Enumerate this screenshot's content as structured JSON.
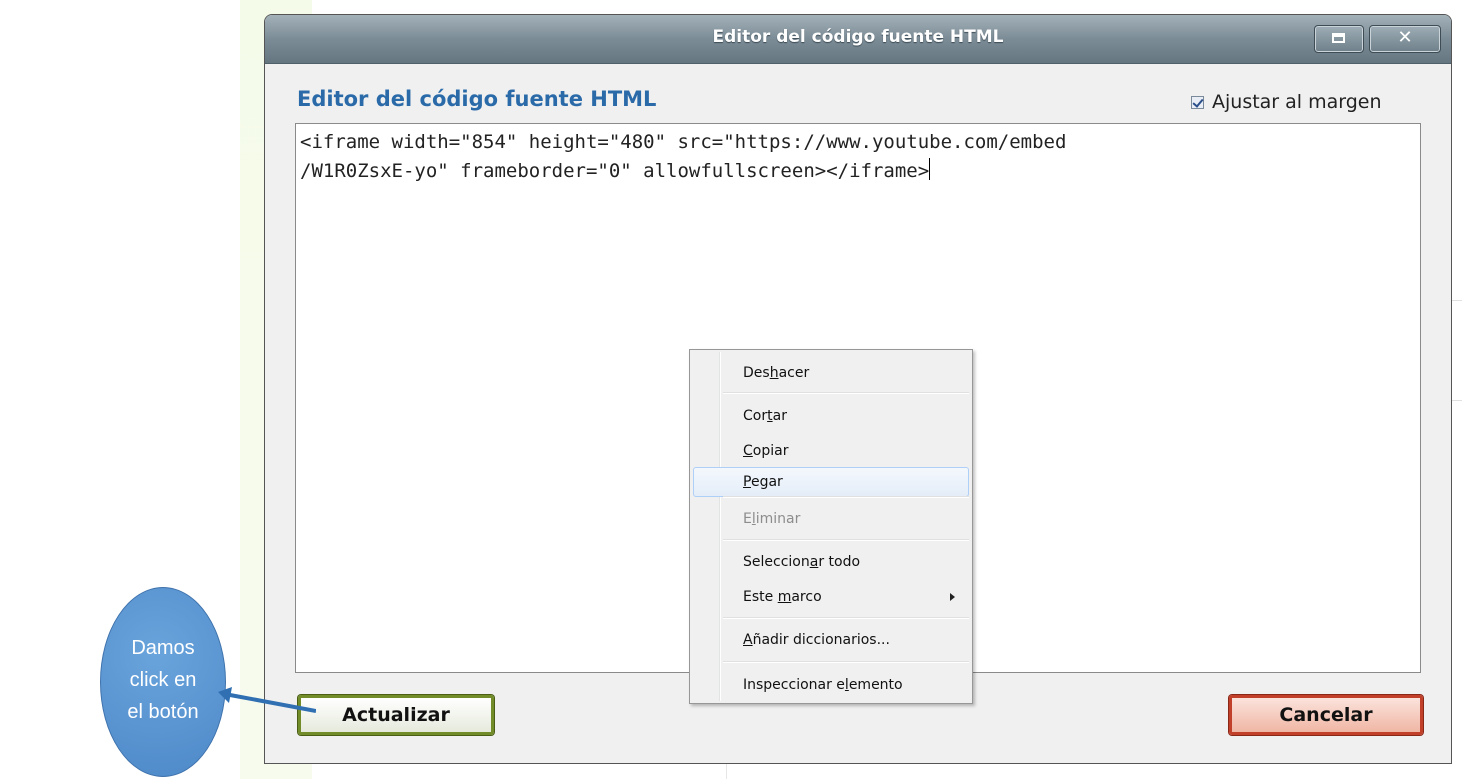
{
  "dialog": {
    "title": "Editor del código fuente HTML",
    "heading": "Editor del código fuente HTML",
    "wrap_option": {
      "label": "Ajustar al margen",
      "checked": true
    },
    "editor": {
      "line1": "<iframe width=\"854\" height=\"480\" src=\"https://www.youtube.com/embed",
      "line2": "/W1R0ZsxE-yo\" frameborder=\"0\" allowfullscreen></iframe>"
    },
    "buttons": {
      "update": "Actualizar",
      "cancel": "Cancelar"
    },
    "window_controls": {
      "maximize": "maximize-icon",
      "close": "✕"
    }
  },
  "context_menu": {
    "items": [
      {
        "pre": "Des",
        "key": "h",
        "post": "acer",
        "state": "normal"
      },
      {
        "pre": "Cor",
        "key": "t",
        "post": "ar",
        "state": "normal"
      },
      {
        "pre": "",
        "key": "C",
        "post": "opiar",
        "state": "normal"
      },
      {
        "pre": "",
        "key": "P",
        "post": "egar",
        "state": "hover"
      },
      {
        "pre": "E",
        "key": "l",
        "post": "iminar",
        "state": "disabled"
      },
      {
        "pre": "Seleccion",
        "key": "a",
        "post": "r todo",
        "state": "normal"
      },
      {
        "pre": "Este ",
        "key": "m",
        "post": "arco",
        "state": "normal",
        "submenu": true
      },
      {
        "pre": "",
        "key": "A",
        "post": "ñadir diccionarios...",
        "state": "normal"
      },
      {
        "pre": "Inspeccionar e",
        "key": "l",
        "post": "emento",
        "state": "normal"
      }
    ]
  },
  "annotation": {
    "line1": "Damos",
    "line2": "click en",
    "line3": "el botón",
    "color": "#5b95d3"
  }
}
